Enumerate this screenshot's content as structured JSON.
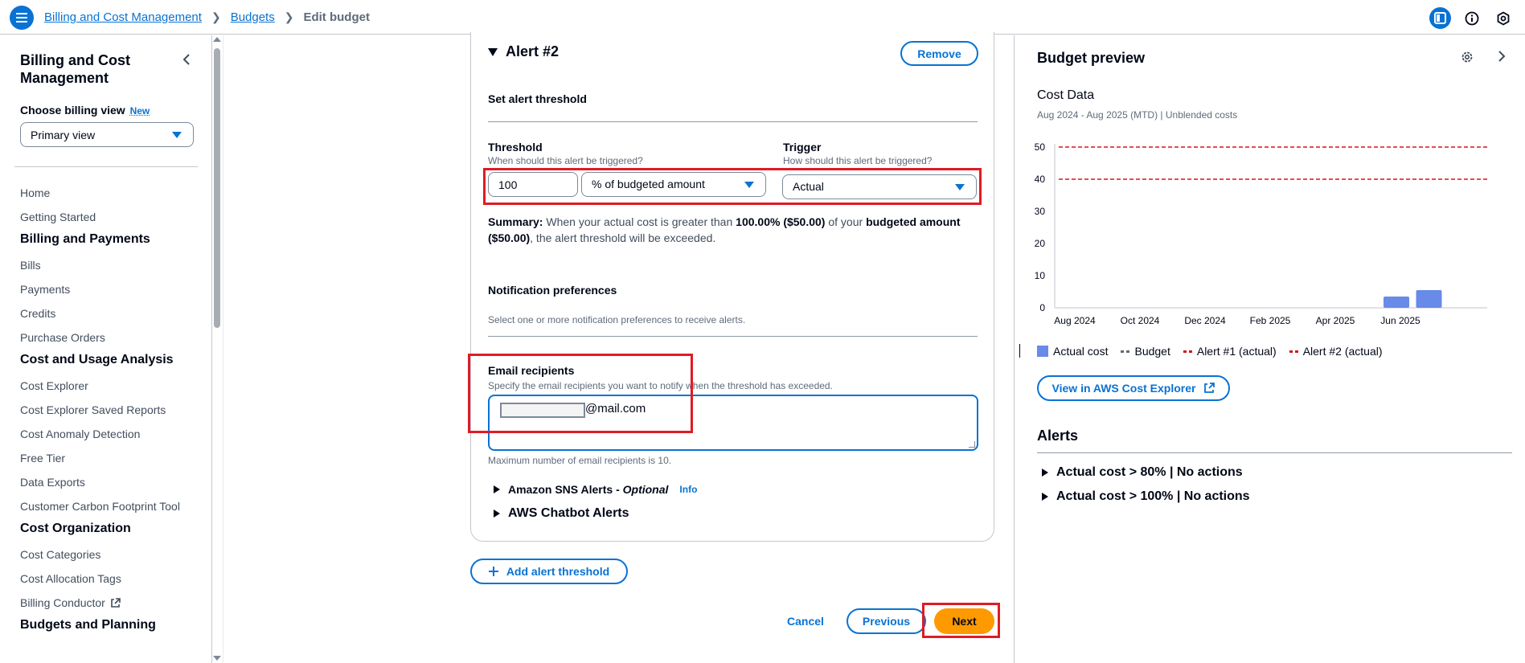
{
  "topbar": {
    "breadcrumb": [
      "Billing and Cost Management",
      "Budgets",
      "Edit budget"
    ],
    "icons": [
      "menu-icon",
      "panel-toggle-icon",
      "info-icon",
      "settings-hexagon-icon"
    ]
  },
  "sidebar": {
    "title": "Billing and Cost Management",
    "billing_view_label": "Choose billing view",
    "billing_view_badge": "New",
    "billing_view_value": "Primary view",
    "items": [
      {
        "type": "link",
        "label": "Home"
      },
      {
        "type": "link",
        "label": "Getting Started"
      },
      {
        "type": "heading",
        "label": "Billing and Payments"
      },
      {
        "type": "link",
        "label": "Bills"
      },
      {
        "type": "link",
        "label": "Payments"
      },
      {
        "type": "link",
        "label": "Credits"
      },
      {
        "type": "link",
        "label": "Purchase Orders"
      },
      {
        "type": "heading",
        "label": "Cost and Usage Analysis"
      },
      {
        "type": "link",
        "label": "Cost Explorer"
      },
      {
        "type": "link",
        "label": "Cost Explorer Saved Reports"
      },
      {
        "type": "link",
        "label": "Cost Anomaly Detection"
      },
      {
        "type": "link",
        "label": "Free Tier"
      },
      {
        "type": "link",
        "label": "Data Exports"
      },
      {
        "type": "link",
        "label": "Customer Carbon Footprint Tool"
      },
      {
        "type": "heading",
        "label": "Cost Organization"
      },
      {
        "type": "link",
        "label": "Cost Categories"
      },
      {
        "type": "link",
        "label": "Cost Allocation Tags"
      },
      {
        "type": "link",
        "label": "Billing Conductor",
        "external": true
      },
      {
        "type": "heading",
        "label": "Budgets and Planning"
      }
    ]
  },
  "alert": {
    "title": "Alert #2",
    "remove_label": "Remove",
    "threshold_section": "Set alert threshold",
    "threshold_label": "Threshold",
    "threshold_desc": "When should this alert be triggered?",
    "threshold_value": "100",
    "threshold_unit": "% of budgeted amount",
    "trigger_label": "Trigger",
    "trigger_desc": "How should this alert be triggered?",
    "trigger_value": "Actual",
    "summary": {
      "prefix": "Summary:",
      "part1": " When your actual cost is greater than ",
      "pct": "100.00% ($50.00)",
      "part2": " of your ",
      "budgeted": "budgeted amount ($50.00)",
      "part3": ", the alert threshold will be exceeded."
    },
    "notif_title": "Notification preferences",
    "notif_desc": "Select one or more notification preferences to receive alerts.",
    "email_label": "Email recipients",
    "email_desc": "Specify the email recipients you want to notify when the threshold has exceeded.",
    "email_domain": "@mail.com",
    "email_hint": "Maximum number of email recipients is 10.",
    "sns_label": "Amazon SNS Alerts - ",
    "sns_optional": "Optional",
    "sns_info": "Info",
    "chatbot_label": "AWS Chatbot Alerts"
  },
  "actions": {
    "add_threshold": "Add alert threshold",
    "cancel": "Cancel",
    "previous": "Previous",
    "next": "Next"
  },
  "preview": {
    "title": "Budget preview",
    "cost_title": "Cost Data",
    "cost_sub": "Aug 2024 - Aug 2025 (MTD) | Unblended costs",
    "legend": [
      "Actual cost",
      "Budget",
      "Alert #1 (actual)",
      "Alert #2 (actual)"
    ],
    "explorer_button": "View in AWS Cost Explorer",
    "alerts_title": "Alerts",
    "alerts": [
      "Actual cost > 80% | No actions",
      "Actual cost > 100% | No actions"
    ]
  },
  "colors": {
    "accent": "#0972d3",
    "primary_button": "#ff9900",
    "actual_cost": "#688ae8",
    "alert_line": "#d91515",
    "highlight_box": "#e01b24"
  },
  "chart_data": {
    "type": "bar",
    "y_ticks": [
      0,
      10,
      20,
      30,
      40,
      50
    ],
    "ylim": [
      0,
      50
    ],
    "x_tick_labels": [
      "Aug 2024",
      "Oct 2024",
      "Dec 2024",
      "Feb 2025",
      "Apr 2025",
      "Jun 2025"
    ],
    "categories": [
      "Aug 2024",
      "Sep 2024",
      "Oct 2024",
      "Nov 2024",
      "Dec 2024",
      "Jan 2025",
      "Feb 2025",
      "Mar 2025",
      "Apr 2025",
      "May 2025",
      "Jun 2025",
      "Jul 2025",
      "Aug 2025"
    ],
    "series": [
      {
        "name": "Actual cost",
        "values": [
          0,
          0,
          0,
          0,
          0,
          0,
          0,
          0,
          0,
          0,
          3.5,
          5.5,
          0
        ]
      }
    ],
    "threshold_lines": [
      {
        "name": "Alert #1 (actual)",
        "value": 40
      },
      {
        "name": "Alert #2 (actual)",
        "value": 50
      }
    ],
    "legend_position": "bottom"
  }
}
